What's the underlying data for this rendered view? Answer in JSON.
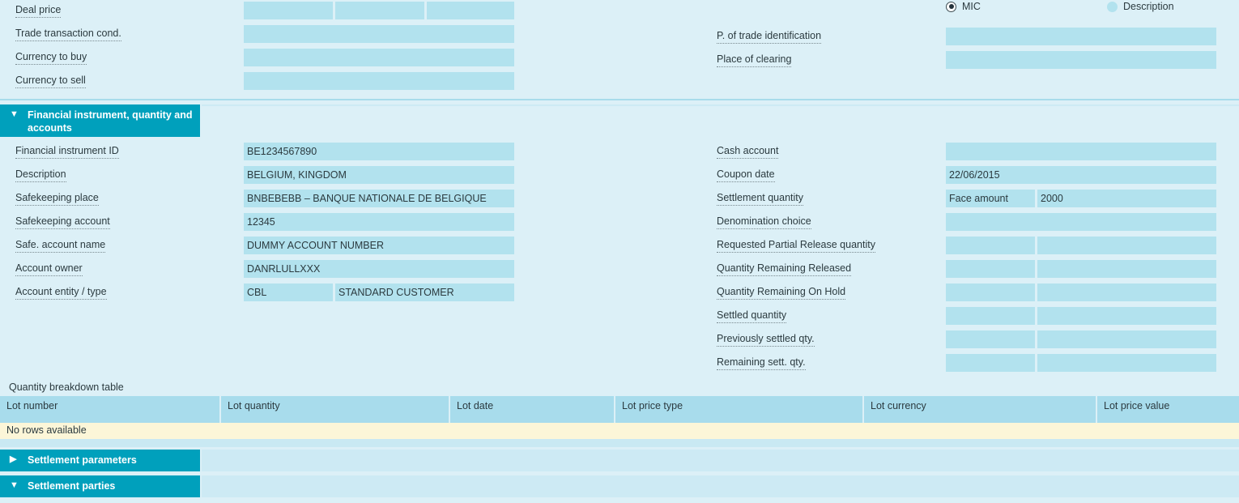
{
  "colors": {
    "background": "#dcf0f7",
    "field_fill": "#b2e2ee",
    "section_header": "#00a0bc",
    "table_header": "#a8dcec",
    "empty_row": "#fcf6d8"
  },
  "top_section": {
    "left_fields": [
      {
        "label": "Deal price",
        "type": "triple",
        "values": [
          "",
          "",
          ""
        ]
      },
      {
        "label": "Trade transaction cond.",
        "type": "single",
        "values": [
          ""
        ]
      },
      {
        "label": "Currency to buy",
        "type": "single",
        "values": [
          ""
        ]
      },
      {
        "label": "Currency to sell",
        "type": "single",
        "values": [
          ""
        ]
      }
    ],
    "right_fields": [
      {
        "label": "P. of trade identification",
        "type": "single",
        "values": [
          ""
        ]
      },
      {
        "label": "Place of clearing",
        "type": "single",
        "values": [
          ""
        ]
      }
    ],
    "radio_group": {
      "name": "place-of-trade-mode",
      "options": [
        {
          "label": "MIC",
          "selected": true
        },
        {
          "label": "Description",
          "selected": false
        }
      ]
    }
  },
  "financial_section": {
    "header": {
      "title": "Financial instrument, quantity and accounts",
      "expanded": true,
      "toggle_glyph": "▼"
    },
    "left_fields": [
      {
        "label": "Financial instrument ID",
        "type": "single",
        "values": [
          "BE1234567890"
        ]
      },
      {
        "label": "Description",
        "type": "single",
        "values": [
          "BELGIUM, KINGDOM"
        ]
      },
      {
        "label": "Safekeeping place",
        "type": "single",
        "values": [
          "BNBEBEBB – BANQUE NATIONALE DE BELGIQUE"
        ]
      },
      {
        "label": "Safekeeping account",
        "type": "single",
        "values": [
          "12345"
        ]
      },
      {
        "label": "Safe. account name",
        "type": "single",
        "values": [
          "DUMMY ACCOUNT NUMBER"
        ]
      },
      {
        "label": "Account owner",
        "type": "single",
        "values": [
          "DANRLULLXXX"
        ]
      },
      {
        "label": "Account entity / type",
        "type": "double",
        "values": [
          "CBL",
          "STANDARD CUSTOMER"
        ]
      }
    ],
    "right_fields": [
      {
        "label": "Cash account",
        "type": "single",
        "values": [
          ""
        ]
      },
      {
        "label": "Coupon date",
        "type": "single",
        "values": [
          "22/06/2015"
        ]
      },
      {
        "label": "Settlement quantity",
        "type": "double",
        "values": [
          "Face amount",
          "2000"
        ]
      },
      {
        "label": "Denomination choice",
        "type": "single",
        "values": [
          ""
        ]
      },
      {
        "label": "Requested Partial Release quantity",
        "type": "double",
        "values": [
          "",
          ""
        ]
      },
      {
        "label": "Quantity Remaining Released",
        "type": "double",
        "values": [
          "",
          ""
        ]
      },
      {
        "label": "Quantity Remaining On Hold",
        "type": "double",
        "values": [
          "",
          ""
        ]
      },
      {
        "label": "Settled quantity",
        "type": "double",
        "values": [
          "",
          ""
        ]
      },
      {
        "label": "Previously settled qty.",
        "type": "double",
        "values": [
          "",
          ""
        ]
      },
      {
        "label": "Remaining sett. qty.",
        "type": "double",
        "values": [
          "",
          ""
        ]
      }
    ]
  },
  "quantity_table": {
    "caption": "Quantity breakdown table",
    "columns": [
      "Lot number",
      "Lot quantity",
      "Lot date",
      "Lot price type",
      "Lot currency",
      "Lot price value"
    ],
    "rows": [],
    "empty_message": "No rows available"
  },
  "collapsed_sections": [
    {
      "title": "Settlement parameters",
      "expanded": false,
      "toggle_glyph": "▶"
    },
    {
      "title": "Settlement parties",
      "expanded": true,
      "toggle_glyph": "▼"
    }
  ]
}
